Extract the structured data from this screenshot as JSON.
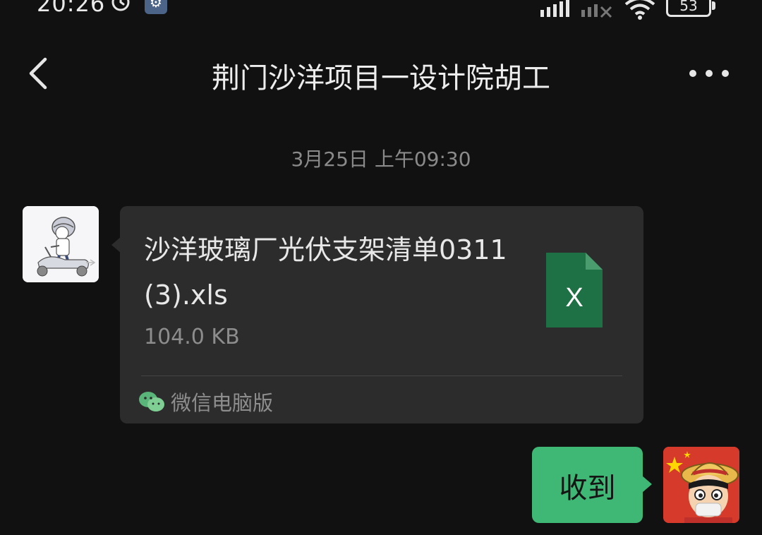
{
  "status_bar": {
    "time": "20:26",
    "battery_level": "53",
    "icons": [
      "alarm-clock-icon",
      "gear-icon",
      "signal-icon",
      "no-signal-icon",
      "wifi-icon",
      "battery-icon"
    ]
  },
  "nav": {
    "back_icon": "chevron-left-icon",
    "title": "荆门沙洋项目一设计院胡工",
    "more_icon": "more-dots-icon"
  },
  "chat": {
    "timestamp": "3月25日 上午09:30",
    "messages": [
      {
        "type": "file",
        "sender": "contact",
        "file_name": "沙洋玻璃厂光伏支架清单0311(3).xls",
        "file_size": "104.0 KB",
        "file_icon": "excel-file-icon",
        "file_icon_letter": "X",
        "source_icon": "wechat-icon",
        "source": "微信电脑版"
      },
      {
        "type": "text",
        "sender": "self",
        "text": "收到"
      }
    ]
  },
  "colors": {
    "background": "#111111",
    "card": "#2c2c2c",
    "self_bubble": "#3eb874",
    "excel_green": "#1e7145",
    "timestamp_gray": "#8a8a8a"
  }
}
